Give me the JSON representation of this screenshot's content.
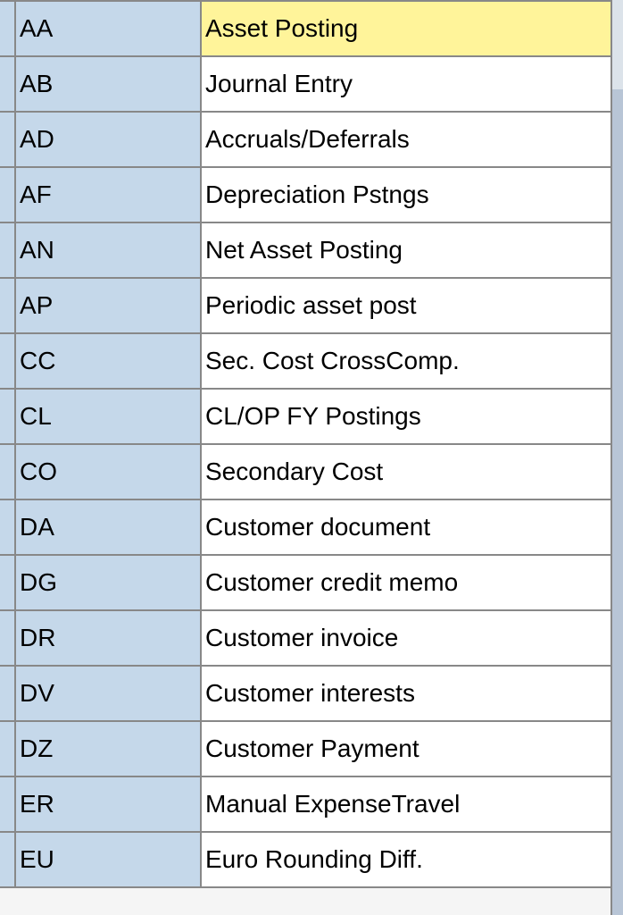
{
  "rows": [
    {
      "code": "AA",
      "description": "Asset Posting",
      "highlighted": true
    },
    {
      "code": "AB",
      "description": "Journal Entry",
      "highlighted": false
    },
    {
      "code": "AD",
      "description": "Accruals/Deferrals",
      "highlighted": false
    },
    {
      "code": "AF",
      "description": "Depreciation Pstngs",
      "highlighted": false
    },
    {
      "code": "AN",
      "description": "Net Asset Posting",
      "highlighted": false
    },
    {
      "code": "AP",
      "description": "Periodic asset post",
      "highlighted": false
    },
    {
      "code": "CC",
      "description": "Sec. Cost CrossComp.",
      "highlighted": false
    },
    {
      "code": "CL",
      "description": "CL/OP FY Postings",
      "highlighted": false
    },
    {
      "code": "CO",
      "description": "Secondary Cost",
      "highlighted": false
    },
    {
      "code": "DA",
      "description": "Customer document",
      "highlighted": false
    },
    {
      "code": "DG",
      "description": "Customer credit memo",
      "highlighted": false
    },
    {
      "code": "DR",
      "description": "Customer invoice",
      "highlighted": false
    },
    {
      "code": "DV",
      "description": "Customer interests",
      "highlighted": false
    },
    {
      "code": "DZ",
      "description": "Customer Payment",
      "highlighted": false
    },
    {
      "code": "ER",
      "description": "Manual ExpenseTravel",
      "highlighted": false
    },
    {
      "code": "EU",
      "description": "Euro Rounding Diff.",
      "highlighted": false
    }
  ]
}
